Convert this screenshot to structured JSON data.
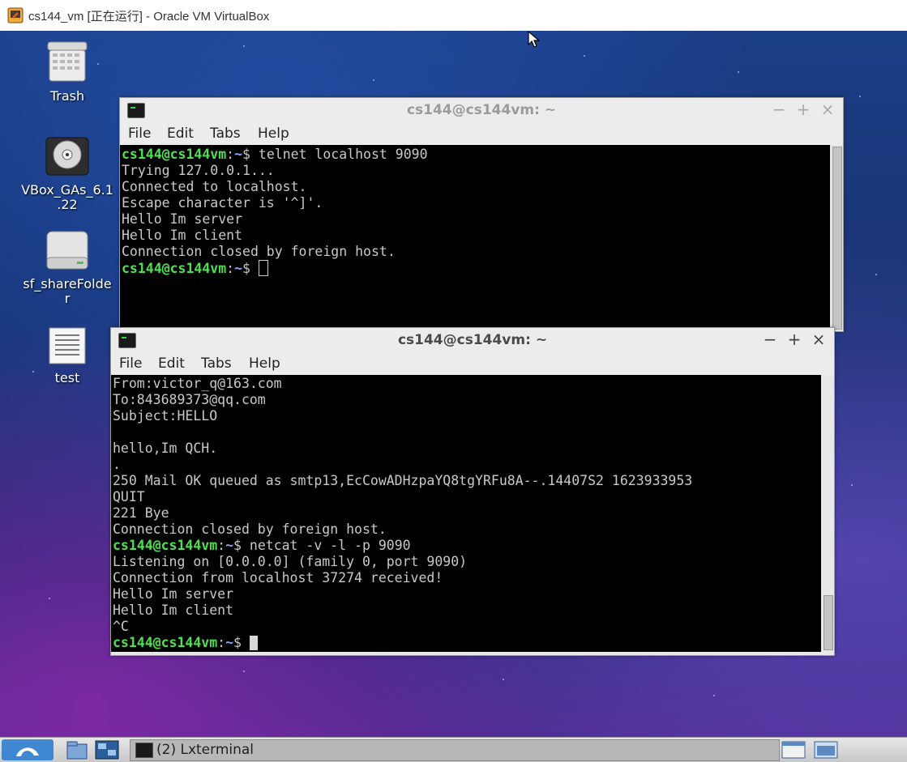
{
  "vbox_window": {
    "title": "cs144_vm [正在运行] - Oracle VM VirtualBox"
  },
  "desktop": {
    "icons": [
      {
        "name": "trash",
        "label": "Trash",
        "icon": "trash-icon"
      },
      {
        "name": "vbox-gas",
        "label": "VBox_GAs_6.1\n.22",
        "icon": "cd-rom-icon"
      },
      {
        "name": "shared-folder",
        "label": "sf_shareFolde\nr",
        "icon": "drive-icon"
      },
      {
        "name": "test-file",
        "label": "test",
        "icon": "text-file-icon"
      }
    ]
  },
  "terminal_back": {
    "title": "cs144@cs144vm: ~",
    "menu": [
      "File",
      "Edit",
      "Tabs",
      "Help"
    ],
    "prompt_user": "cs144@cs144vm",
    "prompt_sep": ":",
    "prompt_path": "~",
    "prompt_dollar": "$ ",
    "command": "telnet localhost 9090",
    "output": [
      "Trying 127.0.0.1...",
      "Connected to localhost.",
      "Escape character is '^]'.",
      "Hello Im server",
      "Hello Im client",
      "Connection closed by foreign host."
    ]
  },
  "terminal_front": {
    "title": "cs144@cs144vm: ~",
    "menu": [
      "File",
      "Edit",
      "Tabs",
      "Help"
    ],
    "prompt_user": "cs144@cs144vm",
    "prompt_sep": ":",
    "prompt_path": "~",
    "prompt_dollar": "$ ",
    "output_before": [
      "From:victor_q@163.com",
      "To:843689373@qq.com",
      "Subject:HELLO",
      "",
      "hello,Im QCH.",
      ".",
      "250 Mail OK queued as smtp13,EcCowADHzpaYQ8tgYRFu8A--.14407S2 1623933953",
      "QUIT",
      "221 Bye",
      "Connection closed by foreign host."
    ],
    "command": "netcat -v -l -p 9090",
    "output_after": [
      "Listening on [0.0.0.0] (family 0, port 9090)",
      "Connection from localhost 37274 received!",
      "Hello Im server",
      "Hello Im client",
      "^C"
    ]
  },
  "taskbar": {
    "task_label": "(2) Lxterminal"
  }
}
